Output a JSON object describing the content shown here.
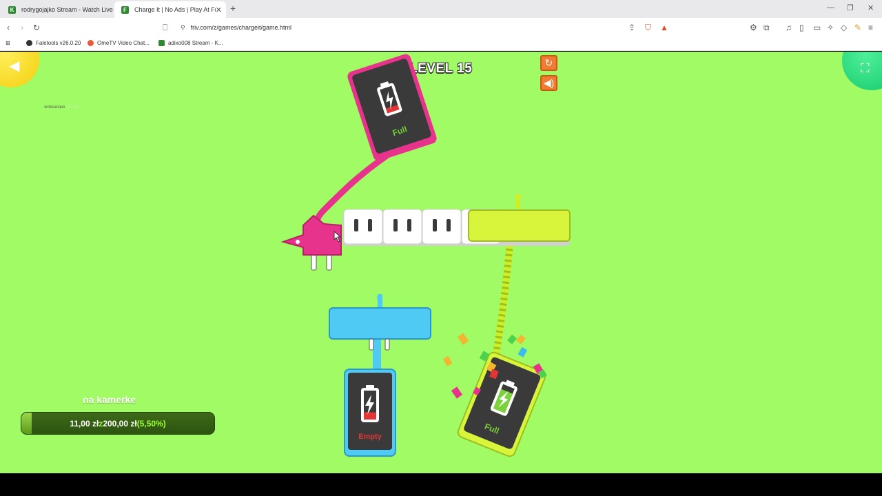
{
  "browser": {
    "tabs": [
      {
        "title": "rodrygojajko Stream - Watch Live on",
        "active": false
      },
      {
        "title": "Charge It | No Ads | Play At Friv",
        "active": true
      }
    ],
    "url": "friv.com/z/games/chargeit/game.html",
    "bookmarks": [
      {
        "label": "Faletools v26.0.20",
        "color": "#333333"
      },
      {
        "label": "OmeTV Video Chat...",
        "color": "#e85a3a"
      },
      {
        "label": "adixo008 Stream - K...",
        "color": "#2f8a32"
      }
    ]
  },
  "game": {
    "level_label": "LEVEL 15",
    "overlay_user": "xroksanaxx",
    "overlay_ghost": "is chill",
    "phones": [
      {
        "id": "pink-phone",
        "status": "Full",
        "color": "#e8338c",
        "charge": 0.2
      },
      {
        "id": "blue-phone",
        "status": "Empty",
        "color": "#3bbcef",
        "charge": 0.25
      },
      {
        "id": "yellow-phone",
        "status": "Full",
        "color": "#c8ef2a",
        "charge": 0.8
      }
    ],
    "power_strip": {
      "sockets": 5,
      "occupied_by": [
        "pink-plug",
        "yellow-plug"
      ]
    },
    "colors": {
      "background": "#a0fb64",
      "pink": "#e8338c",
      "blue": "#4fcaf4",
      "yellow": "#d8f53c",
      "orange_btn": "#f07b32"
    }
  },
  "donation": {
    "label": "na kamerke",
    "current": "11,00 zł",
    "separator": "z",
    "goal": "200,00 zł",
    "percent_text": "(5,50%)",
    "progress": 0.055
  }
}
